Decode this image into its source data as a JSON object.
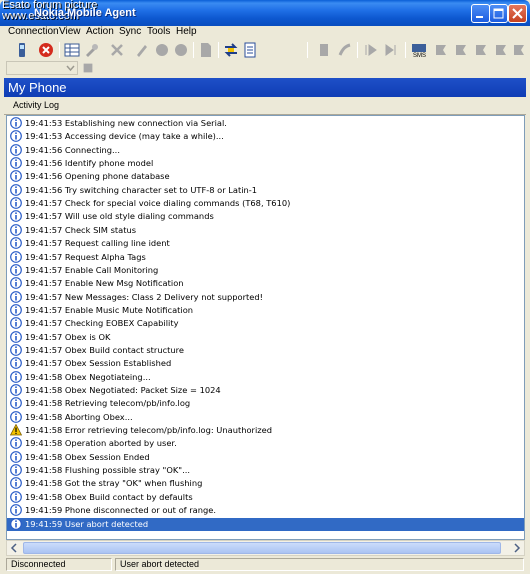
{
  "window": {
    "watermark_line1": "Esato forum picture",
    "watermark_line2": "www.esato.com",
    "title": "Nokia Mobile Agent"
  },
  "menu": [
    {
      "label": "Connection"
    },
    {
      "label": "View"
    },
    {
      "label": "Action"
    },
    {
      "label": "Sync"
    },
    {
      "label": "Tools"
    },
    {
      "label": "Help"
    }
  ],
  "header": {
    "title": "My Phone"
  },
  "tab": {
    "label": "Activity Log"
  },
  "log": [
    {
      "time": "19:41:53",
      "message": "Establishing new connection via Serial.",
      "type": "info"
    },
    {
      "time": "19:41:53",
      "message": "Accessing device (may take a while)...",
      "type": "info"
    },
    {
      "time": "19:41:56",
      "message": "Connecting...",
      "type": "info"
    },
    {
      "time": "19:41:56",
      "message": "Identify phone model",
      "type": "info"
    },
    {
      "time": "19:41:56",
      "message": "Opening phone database",
      "type": "info"
    },
    {
      "time": "19:41:56",
      "message": "Try switching character set to UTF-8 or Latin-1",
      "type": "info"
    },
    {
      "time": "19:41:57",
      "message": "Check for special voice dialing commands (T68, T610)",
      "type": "info"
    },
    {
      "time": "19:41:57",
      "message": "Will use old style dialing commands",
      "type": "info"
    },
    {
      "time": "19:41:57",
      "message": "Check SIM status",
      "type": "info"
    },
    {
      "time": "19:41:57",
      "message": "Request calling line ident",
      "type": "info"
    },
    {
      "time": "19:41:57",
      "message": "Request Alpha Tags",
      "type": "info"
    },
    {
      "time": "19:41:57",
      "message": "Enable Call Monitoring",
      "type": "info"
    },
    {
      "time": "19:41:57",
      "message": "Enable New Msg Notification",
      "type": "info"
    },
    {
      "time": "19:41:57",
      "message": "New Messages: Class 2 Delivery not supported!",
      "type": "info"
    },
    {
      "time": "19:41:57",
      "message": "Enable Music Mute Notification",
      "type": "info"
    },
    {
      "time": "19:41:57",
      "message": "Checking EOBEX Capability",
      "type": "info"
    },
    {
      "time": "19:41:57",
      "message": "Obex is OK",
      "type": "info"
    },
    {
      "time": "19:41:57",
      "message": "Obex Build contact structure",
      "type": "info"
    },
    {
      "time": "19:41:57",
      "message": "Obex Session Established",
      "type": "info"
    },
    {
      "time": "19:41:58",
      "message": "Obex Negotiateing...",
      "type": "info"
    },
    {
      "time": "19:41:58",
      "message": "Obex Negotiated: Packet Size = 1024",
      "type": "info"
    },
    {
      "time": "19:41:58",
      "message": "Retrieving telecom/pb/info.log",
      "type": "info"
    },
    {
      "time": "19:41:58",
      "message": "Aborting Obex...",
      "type": "info"
    },
    {
      "time": "19:41:58",
      "message": "Error retrieving telecom/pb/info.log: Unauthorized",
      "type": "warning"
    },
    {
      "time": "19:41:58",
      "message": "Operation aborted by user.",
      "type": "info"
    },
    {
      "time": "19:41:58",
      "message": "Obex Session Ended",
      "type": "info"
    },
    {
      "time": "19:41:58",
      "message": "Flushing possible stray \"OK\"...",
      "type": "info"
    },
    {
      "time": "19:41:58",
      "message": "Got the stray \"OK\" when flushing",
      "type": "info"
    },
    {
      "time": "19:41:58",
      "message": "Obex Build contact by defaults",
      "type": "info"
    },
    {
      "time": "19:41:59",
      "message": "Phone disconnected or out of range.",
      "type": "info"
    },
    {
      "time": "19:41:59",
      "message": "User abort detected",
      "type": "info",
      "selected": true
    }
  ],
  "status": {
    "connection": "Disconnected",
    "message": "User abort detected"
  },
  "colors": {
    "titlebar": "#0a58d0",
    "header": "#1a4bc4",
    "selection": "#316ac5",
    "info_icon": "#2a5dc8",
    "warning_icon": "#f2c200"
  },
  "toolbar_icons": [
    "phone-icon",
    "disconnect-icon",
    "grid-icon",
    "settings-icon",
    "delete-icon",
    "edit-icon",
    "record-icon",
    "stop-icon",
    "page-icon",
    "transfer-icon",
    "document-icon",
    "fax-icon",
    "call-icon",
    "forward-icon",
    "skip-icon",
    "sms-icon",
    "contact-icon",
    "contact-add-icon",
    "contact-edit-icon",
    "contact-delete-icon",
    "contact-sync-icon"
  ]
}
